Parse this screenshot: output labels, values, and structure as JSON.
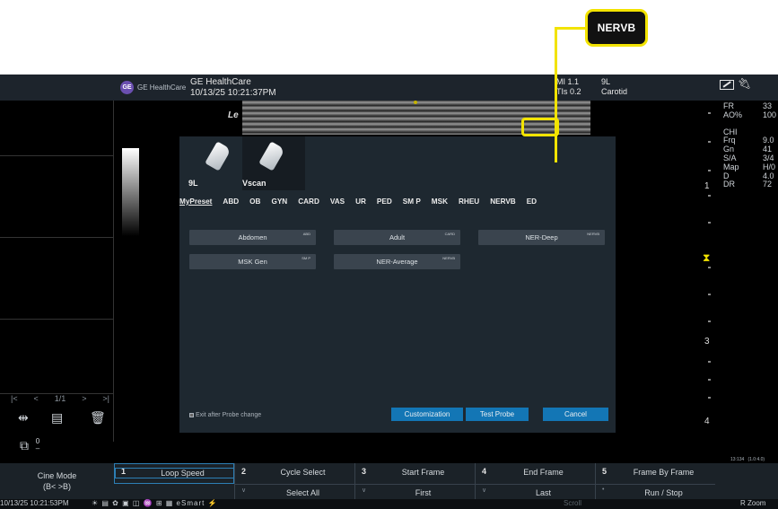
{
  "callout": {
    "label": "NERVB"
  },
  "topbar": {
    "brand": "GE HealthCare",
    "title": "GE HealthCare",
    "datetime": "10/13/25 10:21:37PM",
    "mi": "MI 1.1",
    "tis": "TIs 0.2",
    "probe": "9L",
    "preset": "Carotid",
    "logo_text": "GE"
  },
  "image": {
    "label": "Le"
  },
  "params": [
    {
      "k": "FR",
      "v": "33"
    },
    {
      "k": "AO%",
      "v": "100"
    },
    {
      "k": "",
      "v": ""
    },
    {
      "k": "CHI",
      "v": ""
    },
    {
      "k": "Frq",
      "v": "9.0"
    },
    {
      "k": "Gn",
      "v": "41"
    },
    {
      "k": "S/A",
      "v": "3/4"
    },
    {
      "k": "Map",
      "v": "H/0"
    },
    {
      "k": "D",
      "v": "4.0"
    },
    {
      "k": "DR",
      "v": "72"
    }
  ],
  "depth": {
    "labels": [
      "1",
      "3",
      "4"
    ]
  },
  "cine_nav": {
    "first": "|<",
    "prev": "<",
    "position": "1/1",
    "next": ">",
    "last": ">|"
  },
  "tools": {
    "value": "0"
  },
  "dialog": {
    "probes": [
      {
        "name": "9L"
      },
      {
        "name": "Vscan"
      }
    ],
    "tabs": [
      "MyPreset",
      "ABD",
      "OB",
      "GYN",
      "CARD",
      "VAS",
      "UR",
      "PED",
      "SM P",
      "MSK",
      "RHEU",
      "NERVB",
      "ED"
    ],
    "presets": [
      {
        "label": "Abdomen",
        "tag": "ABD"
      },
      {
        "label": "Adult",
        "tag": "CARD"
      },
      {
        "label": "NER-Deep",
        "tag": "NERVB"
      },
      {
        "label": "MSK Gen",
        "tag": "SM P"
      },
      {
        "label": "NER-Average",
        "tag": "NERVB"
      }
    ],
    "exit_label": "Exit after Probe change",
    "buttons": {
      "customization": "Customization",
      "test_probe": "Test Probe",
      "cancel": "Cancel"
    }
  },
  "mini_readout": {
    "left": "13:134",
    "right": "(1.0:4.0)"
  },
  "bottom": {
    "cine_mode": "Cine Mode",
    "cine_sub": "(B< >B)",
    "keys": [
      {
        "num": "1",
        "label1": "Loop Speed",
        "label2": ""
      },
      {
        "num": "2",
        "label1": "Cycle Select",
        "label2": "Select All"
      },
      {
        "num": "3",
        "label1": "Start Frame",
        "label2": "First"
      },
      {
        "num": "4",
        "label1": "End Frame",
        "label2": "Last"
      },
      {
        "num": "5",
        "label1": "Frame By Frame",
        "label2": "Run / Stop"
      }
    ]
  },
  "status": {
    "datetime": "10/13/25 10:21:53PM",
    "icons": "☀ ▤ ✿ ▣ ◫ ♒ ⊞ ▦ eSmart ⚡",
    "scroll": "Scroll",
    "rzoom": "R Zoom"
  },
  "colors": {
    "highlight": "#f2e300",
    "button_blue": "#1376b5",
    "dialog_bg": "#1e2830"
  }
}
